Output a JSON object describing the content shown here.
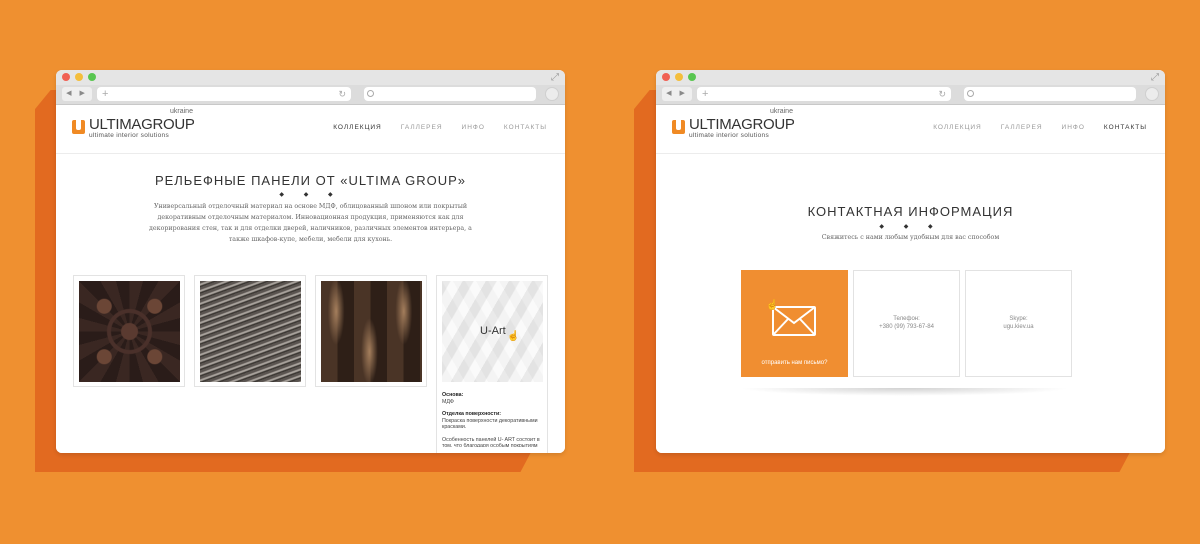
{
  "colors": {
    "background": "#ef9030",
    "shadow": "#e26a20",
    "accent": "#f08e31"
  },
  "brand": {
    "name": "ULTIMAGROUP",
    "region": "ukraine",
    "tagline": "ultimate interior solutions"
  },
  "menu": [
    "КОЛЛЕКЦИЯ",
    "ГАЛЛЕРЕЯ",
    "ИНФО",
    "КОНТАКТЫ"
  ],
  "browser": {
    "nav_glyphs": "◀ ▶",
    "plus": "+",
    "reload": "↻",
    "expand": "⤢"
  },
  "left_page": {
    "active_menu": "КОЛЛЕКЦИЯ",
    "title": "РЕЛЬЕФНЫЕ ПАНЕЛИ ОТ «ULTIMA GROUP»",
    "diamonds": "◆ ◆ ◆",
    "description_lines": [
      "Универсальный отделочный материал на основе МДФ, облицованный шпоном или покрытый",
      "декоративным отделочным материалом. Инновационная продукция, применяются как для",
      "декорирования стен, так и для отделки дверей, наличников, различных элементов интерьера, а",
      "также шкафов-купе, мебели, мебели для кухонь."
    ],
    "cards": [
      {
        "texture": "ornament"
      },
      {
        "texture": "waves"
      },
      {
        "texture": "wood-waves"
      },
      {
        "texture": "u-art",
        "label": "U-Art",
        "base_label": "Основа:",
        "base_value": "МДФ",
        "finish_label": "Отделка поверхности:",
        "finish_value_1": "Покраска поверхности декоративными",
        "finish_value_2": "красками.",
        "note_1": "Особенность панелей U- ART состоит в",
        "note_2": "том, что благодаря особым покрытиям"
      }
    ]
  },
  "right_page": {
    "active_menu": "КОНТАКТЫ",
    "title": "КОНТАКТНАЯ ИНФОРМАЦИЯ",
    "diamonds": "◆ ◆ ◆",
    "subtitle": "Свяжитесь с нами любым удобным для вас способом",
    "mail_label": "отправить нам письмо?",
    "phone_label": "Телефон:",
    "phone_value": "+380 (99) 793-67-84",
    "skype_label": "Skype:",
    "skype_value": "ugu.kiev.ua"
  }
}
